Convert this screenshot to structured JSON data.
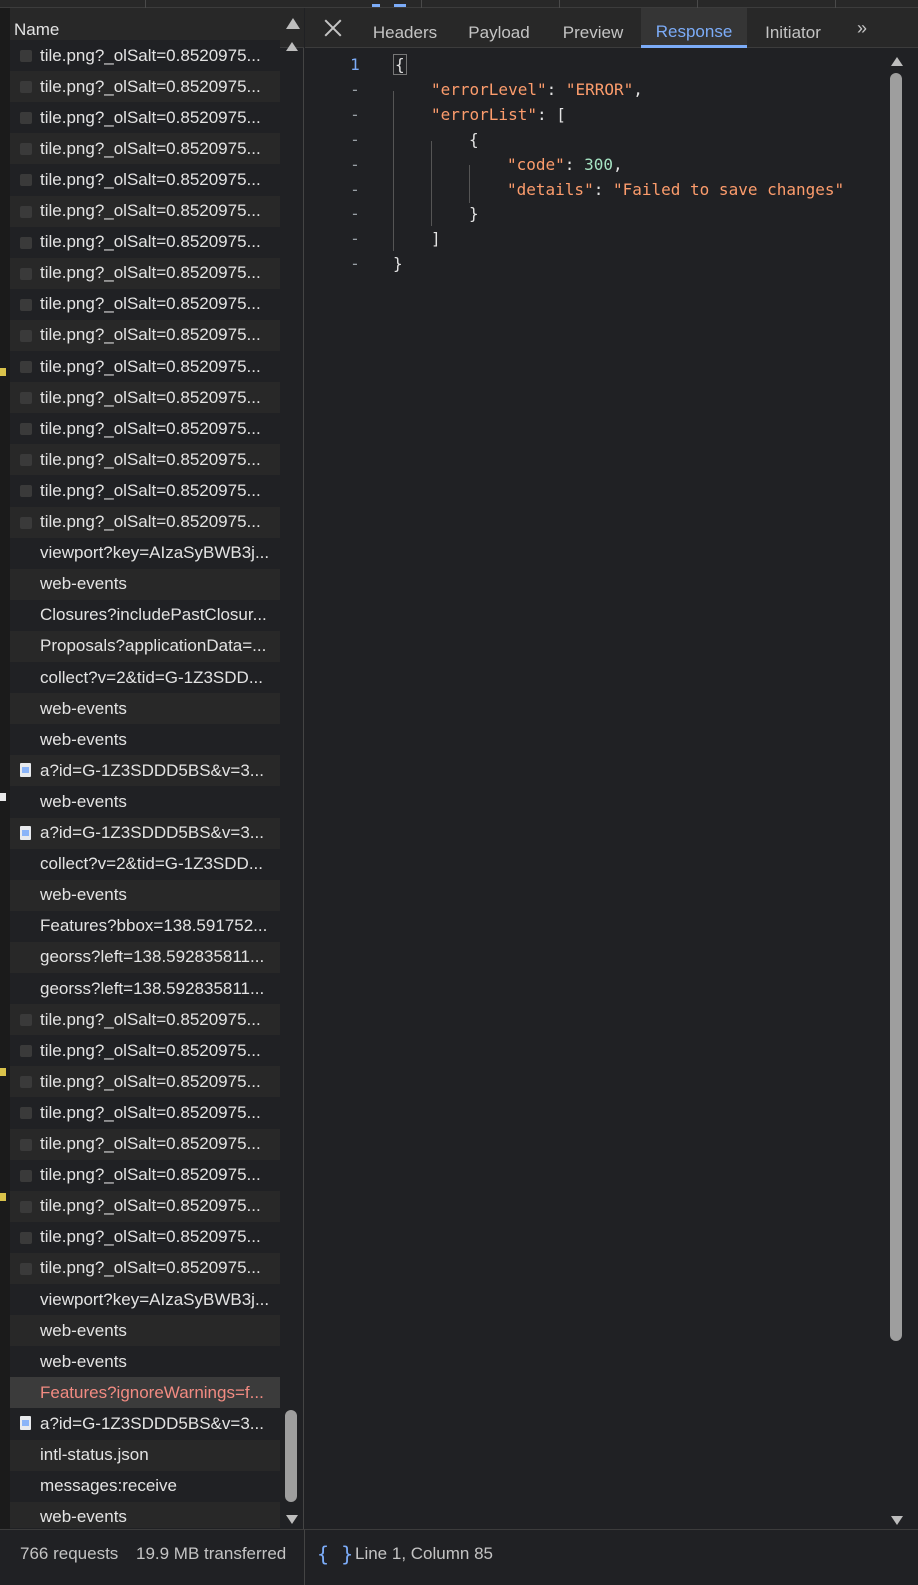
{
  "list": {
    "header": "Name",
    "rows": [
      {
        "name": "tile.png?_olSalt=0.8520975...",
        "icon": "thumb"
      },
      {
        "name": "tile.png?_olSalt=0.8520975...",
        "icon": "thumb"
      },
      {
        "name": "tile.png?_olSalt=0.8520975...",
        "icon": "thumb"
      },
      {
        "name": "tile.png?_olSalt=0.8520975...",
        "icon": "thumb"
      },
      {
        "name": "tile.png?_olSalt=0.8520975...",
        "icon": "thumb"
      },
      {
        "name": "tile.png?_olSalt=0.8520975...",
        "icon": "thumb"
      },
      {
        "name": "tile.png?_olSalt=0.8520975...",
        "icon": "thumb"
      },
      {
        "name": "tile.png?_olSalt=0.8520975...",
        "icon": "thumb"
      },
      {
        "name": "tile.png?_olSalt=0.8520975...",
        "icon": "thumb"
      },
      {
        "name": "tile.png?_olSalt=0.8520975...",
        "icon": "thumb"
      },
      {
        "name": "tile.png?_olSalt=0.8520975...",
        "icon": "thumb"
      },
      {
        "name": "tile.png?_olSalt=0.8520975...",
        "icon": "thumb"
      },
      {
        "name": "tile.png?_olSalt=0.8520975...",
        "icon": "thumb"
      },
      {
        "name": "tile.png?_olSalt=0.8520975...",
        "icon": "thumb"
      },
      {
        "name": "tile.png?_olSalt=0.8520975...",
        "icon": "thumb"
      },
      {
        "name": "tile.png?_olSalt=0.8520975...",
        "icon": "thumb"
      },
      {
        "name": "viewport?key=AIzaSyBWB3j...",
        "icon": "none"
      },
      {
        "name": "web-events",
        "icon": "none"
      },
      {
        "name": "Closures?includePastClosur...",
        "icon": "none"
      },
      {
        "name": "Proposals?applicationData=...",
        "icon": "none"
      },
      {
        "name": "collect?v=2&tid=G-1Z3SDD...",
        "icon": "none"
      },
      {
        "name": "web-events",
        "icon": "none"
      },
      {
        "name": "web-events",
        "icon": "none"
      },
      {
        "name": "a?id=G-1Z3SDDD5BS&v=3...",
        "icon": "doc"
      },
      {
        "name": "web-events",
        "icon": "none"
      },
      {
        "name": "a?id=G-1Z3SDDD5BS&v=3...",
        "icon": "doc"
      },
      {
        "name": "collect?v=2&tid=G-1Z3SDD...",
        "icon": "none"
      },
      {
        "name": "web-events",
        "icon": "none"
      },
      {
        "name": "Features?bbox=138.591752...",
        "icon": "none"
      },
      {
        "name": "georss?left=138.592835811...",
        "icon": "none"
      },
      {
        "name": "georss?left=138.592835811...",
        "icon": "none"
      },
      {
        "name": "tile.png?_olSalt=0.8520975...",
        "icon": "thumb"
      },
      {
        "name": "tile.png?_olSalt=0.8520975...",
        "icon": "thumb"
      },
      {
        "name": "tile.png?_olSalt=0.8520975...",
        "icon": "thumb"
      },
      {
        "name": "tile.png?_olSalt=0.8520975...",
        "icon": "thumb"
      },
      {
        "name": "tile.png?_olSalt=0.8520975...",
        "icon": "thumb"
      },
      {
        "name": "tile.png?_olSalt=0.8520975...",
        "icon": "thumb"
      },
      {
        "name": "tile.png?_olSalt=0.8520975...",
        "icon": "thumb"
      },
      {
        "name": "tile.png?_olSalt=0.8520975...",
        "icon": "thumb"
      },
      {
        "name": "tile.png?_olSalt=0.8520975...",
        "icon": "thumb"
      },
      {
        "name": "viewport?key=AIzaSyBWB3j...",
        "icon": "none"
      },
      {
        "name": "web-events",
        "icon": "none"
      },
      {
        "name": "web-events",
        "icon": "none"
      },
      {
        "name": "Features?ignoreWarnings=f...",
        "icon": "none",
        "error": true,
        "selected": true
      },
      {
        "name": "a?id=G-1Z3SDDD5BS&v=3...",
        "icon": "doc"
      },
      {
        "name": "intl-status.json",
        "icon": "none"
      },
      {
        "name": "messages:receive",
        "icon": "none"
      },
      {
        "name": "web-events",
        "icon": "none"
      }
    ]
  },
  "tabs": {
    "headers": "Headers",
    "payload": "Payload",
    "preview": "Preview",
    "response": "Response",
    "initiator": "Initiator",
    "more": "»"
  },
  "response": {
    "gutter": [
      "1",
      "-",
      "-",
      "-",
      "-",
      "-",
      "-",
      "-",
      "-"
    ],
    "lines": [
      {
        "indent": 0,
        "parts": [
          {
            "t": "{",
            "c": "p"
          }
        ]
      },
      {
        "indent": 1,
        "parts": [
          {
            "t": "\"errorLevel\"",
            "c": "k"
          },
          {
            "t": ": ",
            "c": "p"
          },
          {
            "t": "\"ERROR\"",
            "c": "s"
          },
          {
            "t": ",",
            "c": "p"
          }
        ]
      },
      {
        "indent": 1,
        "parts": [
          {
            "t": "\"errorList\"",
            "c": "k"
          },
          {
            "t": ": [",
            "c": "p"
          }
        ]
      },
      {
        "indent": 2,
        "parts": [
          {
            "t": "{",
            "c": "p"
          }
        ]
      },
      {
        "indent": 3,
        "parts": [
          {
            "t": "\"code\"",
            "c": "k"
          },
          {
            "t": ": ",
            "c": "p"
          },
          {
            "t": "300",
            "c": "n"
          },
          {
            "t": ",",
            "c": "p"
          }
        ]
      },
      {
        "indent": 3,
        "parts": [
          {
            "t": "\"details\"",
            "c": "k"
          },
          {
            "t": ": ",
            "c": "p"
          },
          {
            "t": "\"Failed to save changes\"",
            "c": "s"
          }
        ]
      },
      {
        "indent": 2,
        "parts": [
          {
            "t": "}",
            "c": "p"
          }
        ]
      },
      {
        "indent": 1,
        "parts": [
          {
            "t": "]",
            "c": "p"
          }
        ]
      },
      {
        "indent": 0,
        "parts": [
          {
            "t": "}",
            "c": "p"
          }
        ]
      }
    ]
  },
  "status": {
    "requests": "766 requests",
    "transferred": "19.9 MB transferred",
    "format_icon": "{ }",
    "cursor": "Line 1, Column 85"
  },
  "colors": {
    "accent": "#7cacf8",
    "json_key": "#fc9c6c",
    "json_number": "#a6e3c3",
    "error_text": "#f28b82"
  }
}
